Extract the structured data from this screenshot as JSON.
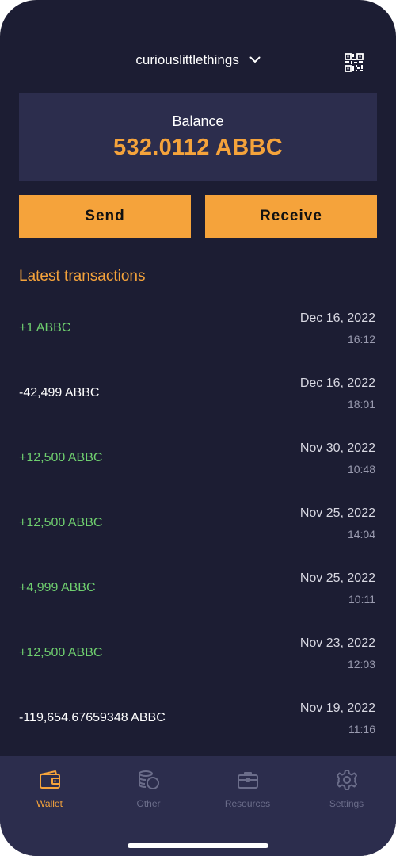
{
  "header": {
    "account_name": "curiouslittlethings",
    "chevron_icon": "chevron-down-icon",
    "qr_icon": "qr-code-icon"
  },
  "balance": {
    "label": "Balance",
    "value": "532.0112 ABBC"
  },
  "actions": {
    "send_label": "Send",
    "receive_label": "Receive"
  },
  "transactions_title": "Latest transactions",
  "transactions": [
    {
      "amount": "+1 ABBC",
      "type": "incoming",
      "date": "Dec 16, 2022",
      "time": "16:12"
    },
    {
      "amount": "-42,499 ABBC",
      "type": "outgoing",
      "date": "Dec 16, 2022",
      "time": "18:01"
    },
    {
      "amount": "+12,500 ABBC",
      "type": "incoming",
      "date": "Nov 30, 2022",
      "time": "10:48"
    },
    {
      "amount": "+12,500 ABBC",
      "type": "incoming",
      "date": "Nov 25, 2022",
      "time": "14:04"
    },
    {
      "amount": "+4,999 ABBC",
      "type": "incoming",
      "date": "Nov 25, 2022",
      "time": "10:11"
    },
    {
      "amount": "+12,500 ABBC",
      "type": "incoming",
      "date": "Nov 23, 2022",
      "time": "12:03"
    },
    {
      "amount": "-119,654.67659348 ABBC",
      "type": "outgoing",
      "date": "Nov 19, 2022",
      "time": "11:16"
    }
  ],
  "tabs": [
    {
      "label": "Wallet",
      "icon": "wallet-icon",
      "active": true
    },
    {
      "label": "Other",
      "icon": "coins-icon",
      "active": false
    },
    {
      "label": "Resources",
      "icon": "briefcase-icon",
      "active": false
    },
    {
      "label": "Settings",
      "icon": "gear-icon",
      "active": false
    }
  ],
  "colors": {
    "background": "#1c1d33",
    "card": "#2c2d4d",
    "accent": "#f5a33b",
    "positive": "#6fcf6f",
    "inactive": "#6b6d8a"
  }
}
